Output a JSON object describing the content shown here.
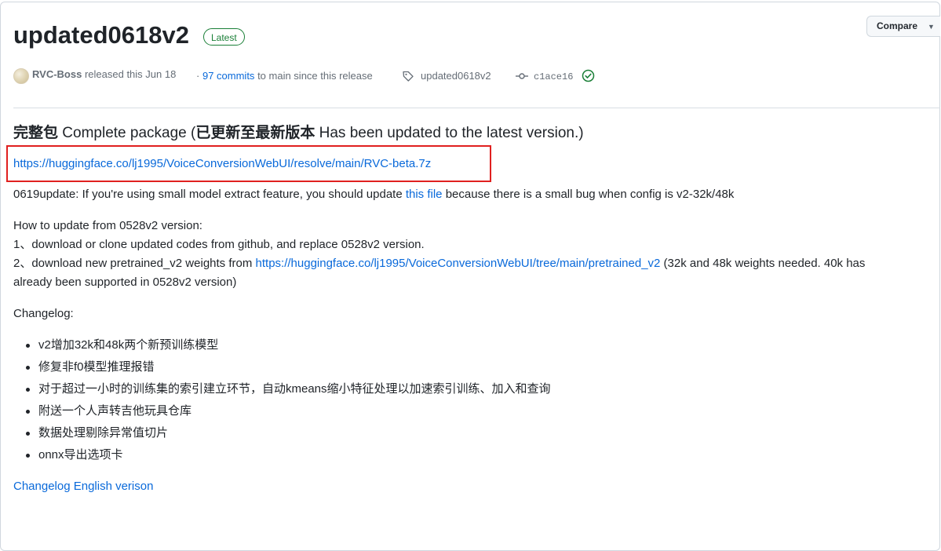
{
  "release": {
    "title": "updated0618v2",
    "badge": "Latest",
    "compare_label": "Compare",
    "author": "RVC-Boss",
    "released_text": "released this Jun 18",
    "commits_prefix": "·",
    "commits_link": "97 commits",
    "commits_suffix": "to main since this release",
    "tag": "updated0618v2",
    "commit_sha": "c1ace16"
  },
  "body": {
    "heading_bold_1": "完整包",
    "heading_text_1": " Complete package (",
    "heading_bold_2": "已更新至最新版本",
    "heading_text_2": " Has been updated to the latest version.)",
    "download_link": "https://huggingface.co/lj1995/VoiceConversionWebUI/resolve/main/RVC-beta.7z",
    "update_note_prefix": "0619update: If you're using small model extract feature, you should update ",
    "update_note_link": "this file",
    "update_note_suffix": " because there is a small bug when config is v2-32k/48k",
    "howto_title": "How to update from 0528v2 version:",
    "howto_step1": "1、download or clone updated codes from github, and replace 0528v2 version.",
    "howto_step2_prefix": "2、download new pretrained_v2 weights from ",
    "howto_step2_link": "https://huggingface.co/lj1995/VoiceConversionWebUI/tree/main/pretrained_v2",
    "howto_step2_suffix": " (32k and 48k weights needed. 40k has",
    "howto_step2_line2": "already been supported in 0528v2 version)",
    "changelog_title": "Changelog:",
    "changelog_items": [
      "v2增加32k和48k两个新预训练模型",
      "修复非f0模型推理报错",
      "对于超过一小时的训练集的索引建立环节，自动kmeans缩小特征处理以加速索引训练、加入和查询",
      "附送一个人声转吉他玩具仓库",
      "数据处理剔除异常值切片",
      "onnx导出选项卡"
    ],
    "changelog_english_link": "Changelog English verison"
  }
}
